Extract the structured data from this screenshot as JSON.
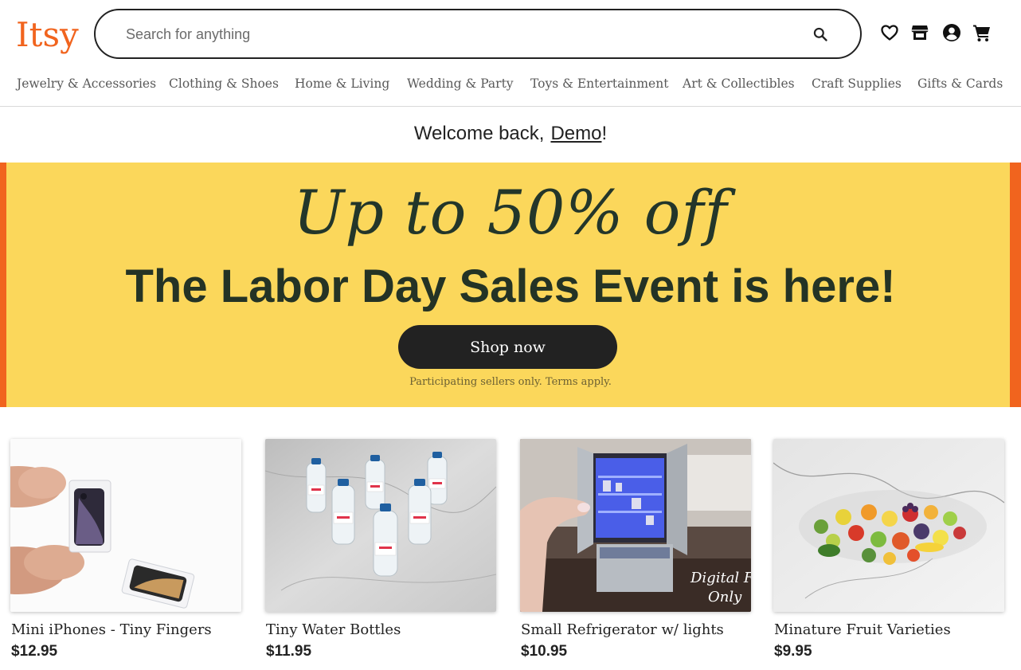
{
  "header": {
    "logo": "Itsy",
    "search": {
      "placeholder": "Search for anything",
      "value": ""
    },
    "icons": [
      "heart-icon",
      "shop-icon",
      "user-icon",
      "cart-icon"
    ]
  },
  "categories": [
    "Jewelry & Accessories",
    "Clothing & Shoes",
    "Home & Living",
    "Wedding & Party",
    "Toys & Entertainment",
    "Art & Collectibles",
    "Craft Supplies",
    "Gifts & Cards"
  ],
  "welcome": {
    "prefix": "Welcome back,",
    "user": "Demo",
    "suffix": "!"
  },
  "banner": {
    "subtitle": "Up to 50% off",
    "title": "The Labor Day Sales Event is here!",
    "button": "Shop now",
    "terms": "Participating sellers only. Terms apply.",
    "colors": {
      "background": "#fbd75b",
      "accent": "#f1641e",
      "text": "#243325"
    }
  },
  "products": [
    {
      "name": "Mini iPhones - Tiny Fingers",
      "price": "$12.95"
    },
    {
      "name": "Tiny Water Bottles",
      "price": "$11.95"
    },
    {
      "name": "Small Refrigerator w/ lights",
      "price": "$10.95",
      "image_text": "Digital File Only"
    },
    {
      "name": "Minature Fruit Varieties",
      "price": "$9.95"
    }
  ]
}
